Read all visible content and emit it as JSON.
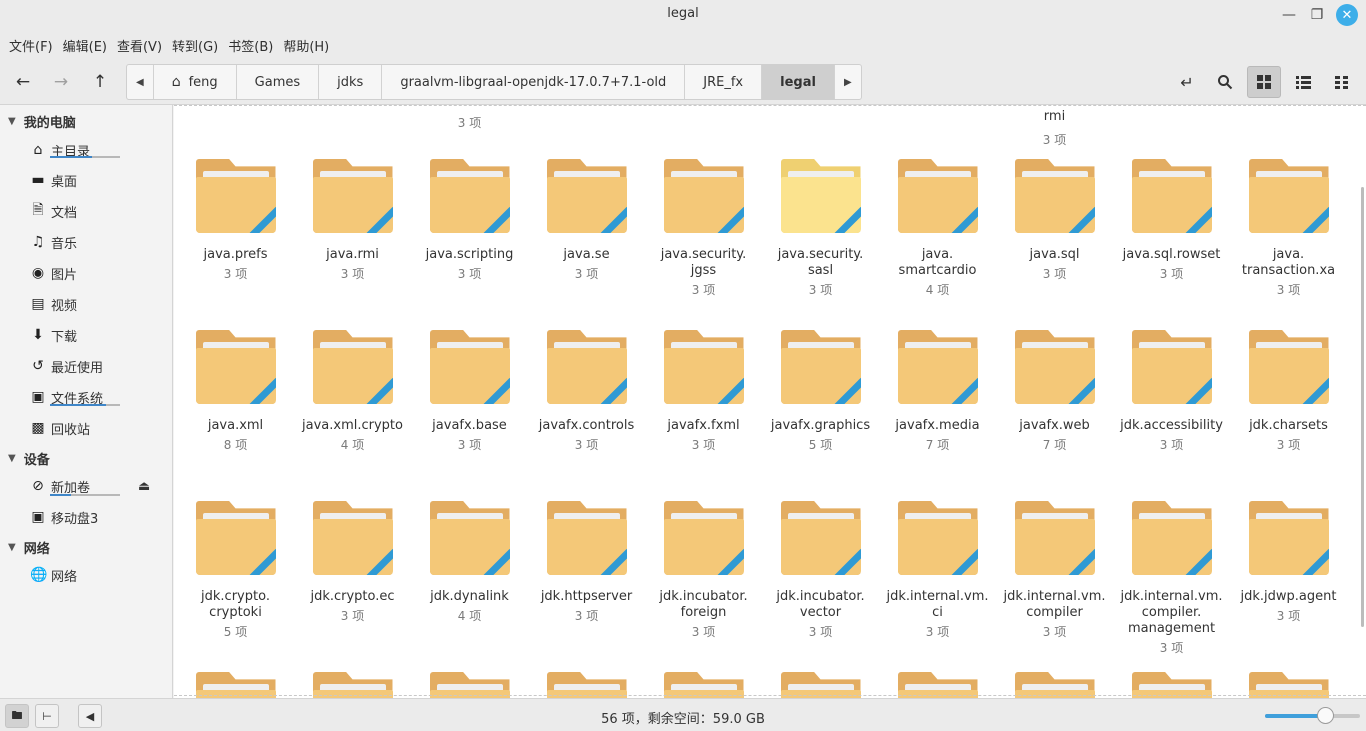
{
  "window": {
    "title": "legal"
  },
  "menu": [
    "文件(F)",
    "编辑(E)",
    "查看(V)",
    "转到(G)",
    "书签(B)",
    "帮助(H)"
  ],
  "breadcrumbs": [
    "feng",
    "Games",
    "jdks",
    "graalvm-libgraal-openjdk-17.0.7+7.1-old",
    "JRE_fx",
    "legal"
  ],
  "sidebar": {
    "computer_header": "我的电脑",
    "computer_items": [
      {
        "label": "主目录",
        "icon": "home-icon",
        "usage": 0.6
      },
      {
        "label": "桌面",
        "icon": "desktop-icon"
      },
      {
        "label": "文档",
        "icon": "document-icon"
      },
      {
        "label": "音乐",
        "icon": "music-icon"
      },
      {
        "label": "图片",
        "icon": "camera-icon"
      },
      {
        "label": "视频",
        "icon": "video-icon"
      },
      {
        "label": "下载",
        "icon": "download-icon"
      },
      {
        "label": "最近使用",
        "icon": "recent-icon"
      },
      {
        "label": "文件系统",
        "icon": "drive-icon",
        "usage": 0.8
      },
      {
        "label": "回收站",
        "icon": "trash-icon"
      }
    ],
    "devices_header": "设备",
    "devices_items": [
      {
        "label": "新加卷",
        "icon": "volume-icon",
        "usage": 0.3
      },
      {
        "label": "移动盘3",
        "icon": "drive-icon"
      }
    ],
    "network_header": "网络",
    "network_items": [
      {
        "label": "网络",
        "icon": "network-icon"
      }
    ]
  },
  "partial_top": [
    {
      "count": "3 项"
    },
    {
      "name": "rmi",
      "count": "3 项"
    }
  ],
  "files": [
    {
      "name": "java.prefs",
      "count": "3 项"
    },
    {
      "name": "java.rmi",
      "count": "3 项"
    },
    {
      "name": "java.scripting",
      "count": "3 项"
    },
    {
      "name": "java.se",
      "count": "3 项"
    },
    {
      "name": "java.security.\njgss",
      "count": "3 项"
    },
    {
      "name": "java.security.\nsasl",
      "count": "3 项",
      "highlight": true
    },
    {
      "name": "java.\nsmartcardio",
      "count": "4 项"
    },
    {
      "name": "java.sql",
      "count": "3 项"
    },
    {
      "name": "java.sql.rowset",
      "count": "3 项"
    },
    {
      "name": "java.\ntransaction.xa",
      "count": "3 项"
    },
    {
      "name": "java.xml",
      "count": "8 项"
    },
    {
      "name": "java.xml.crypto",
      "count": "4 项"
    },
    {
      "name": "javafx.base",
      "count": "3 项"
    },
    {
      "name": "javafx.controls",
      "count": "3 项"
    },
    {
      "name": "javafx.fxml",
      "count": "3 项"
    },
    {
      "name": "javafx.graphics",
      "count": "5 项"
    },
    {
      "name": "javafx.media",
      "count": "7 项"
    },
    {
      "name": "javafx.web",
      "count": "7 项"
    },
    {
      "name": "jdk.accessibility",
      "count": "3 项"
    },
    {
      "name": "jdk.charsets",
      "count": "3 项"
    },
    {
      "name": "jdk.crypto.\ncryptoki",
      "count": "5 项"
    },
    {
      "name": "jdk.crypto.ec",
      "count": "3 项"
    },
    {
      "name": "jdk.dynalink",
      "count": "4 项"
    },
    {
      "name": "jdk.httpserver",
      "count": "3 项"
    },
    {
      "name": "jdk.incubator.\nforeign",
      "count": "3 项"
    },
    {
      "name": "jdk.incubator.\nvector",
      "count": "3 项"
    },
    {
      "name": "jdk.internal.vm.\nci",
      "count": "3 项"
    },
    {
      "name": "jdk.internal.vm.\ncompiler",
      "count": "3 项"
    },
    {
      "name": "jdk.internal.vm.\ncompiler.\nmanagement",
      "count": "3 项"
    },
    {
      "name": "jdk.jdwp.agent",
      "count": "3 项"
    }
  ],
  "status": {
    "text": "56 项，剩余空间：59.0 GB",
    "zoom": 0.63
  }
}
